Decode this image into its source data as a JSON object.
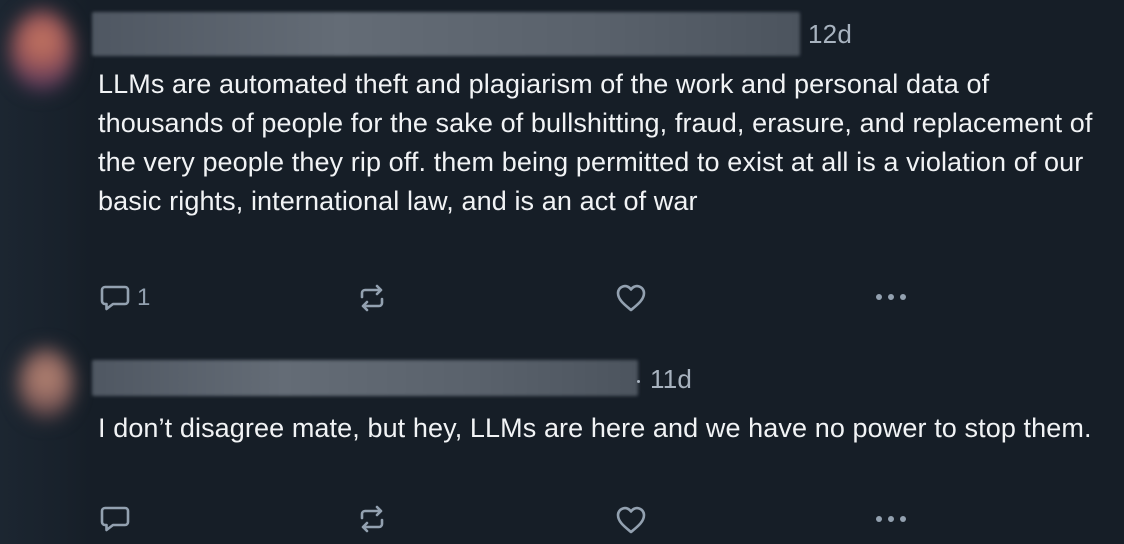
{
  "posts": [
    {
      "time": "12d",
      "text": "LLMs are automated theft and plagiarism of the work and personal data of thousands of people for the sake of bullshitting, fraud, erasure, and replacement of the very people they rip off. them being permitted to exist at all is a violation of our basic rights, international law, and is an act of war",
      "reply_count": "1",
      "icons": {
        "reply": "speech-bubble-icon",
        "repost": "repost-arrows-icon",
        "like": "heart-icon",
        "more": "ellipsis-icon"
      }
    },
    {
      "time": "11d",
      "text": "I don’t disagree mate, but hey, LLMs are here and we have no power to stop them.",
      "reply_count": "",
      "icons": {
        "reply": "speech-bubble-icon",
        "repost": "repost-arrows-icon",
        "like": "heart-icon",
        "more": "ellipsis-icon"
      }
    }
  ],
  "colors": {
    "background": "#161e27",
    "text": "#f1f3f5",
    "muted": "#93a1b0",
    "timestamp": "#a8b3bf"
  }
}
